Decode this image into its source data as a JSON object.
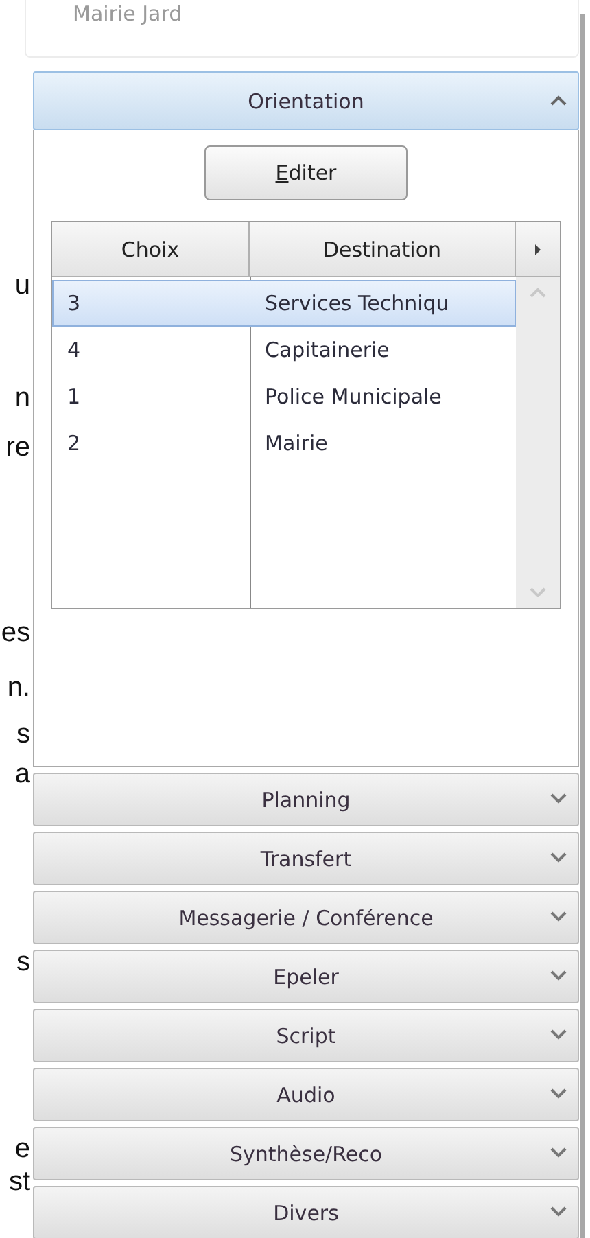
{
  "background_card": {
    "label": "Mairie Jard"
  },
  "left_text_fragments": [
    "u",
    "n",
    "re",
    "es",
    "n.",
    "s",
    "a",
    "s",
    "e",
    "st"
  ],
  "sections": [
    {
      "title": "Orientation",
      "expanded": true,
      "edit_button": "Editer",
      "table": {
        "columns": [
          "Choix",
          "Destination"
        ],
        "rows": [
          {
            "cells": [
              "3",
              "Services Techniqu"
            ],
            "selected": true
          },
          {
            "cells": [
              "4",
              "Capitainerie"
            ],
            "selected": false
          },
          {
            "cells": [
              "1",
              "Police Municipale"
            ],
            "selected": false
          },
          {
            "cells": [
              "2",
              "Mairie"
            ],
            "selected": false
          }
        ]
      }
    },
    {
      "title": "Planning",
      "expanded": false
    },
    {
      "title": "Transfert",
      "expanded": false
    },
    {
      "title": "Messagerie / Conférence",
      "expanded": false
    },
    {
      "title": "Epeler",
      "expanded": false
    },
    {
      "title": "Script",
      "expanded": false
    },
    {
      "title": "Audio",
      "expanded": false
    },
    {
      "title": "Synthèse/Reco",
      "expanded": false
    },
    {
      "title": "Divers",
      "expanded": false
    }
  ]
}
